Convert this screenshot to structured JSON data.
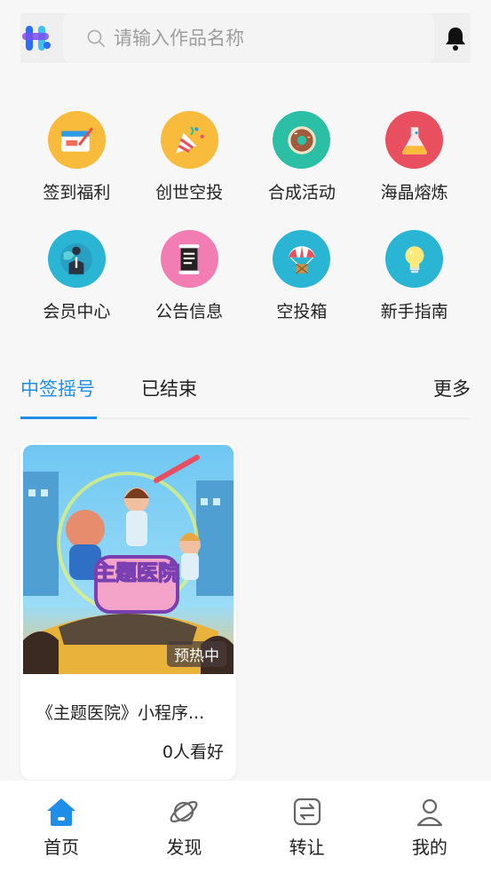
{
  "header": {
    "search_placeholder": "请输入作品名称"
  },
  "grid": [
    {
      "label": "签到福利",
      "color": "#f8bb3c"
    },
    {
      "label": "创世空投",
      "color": "#f8bb3c"
    },
    {
      "label": "合成活动",
      "color": "#2bbfa6"
    },
    {
      "label": "海晶熔炼",
      "color": "#e8505f"
    },
    {
      "label": "会员中心",
      "color": "#2ab5d5"
    },
    {
      "label": "公告信息",
      "color": "#f27db3"
    },
    {
      "label": "空投箱",
      "color": "#2ab5d5"
    },
    {
      "label": "新手指南",
      "color": "#2ab5d5"
    }
  ],
  "tabs": {
    "items": [
      "中签摇号",
      "已结束"
    ],
    "more": "更多",
    "active_color": "#1e8ee8"
  },
  "card": {
    "badge": "预热中",
    "title": "《主题医院》小程序...",
    "views": "0人看好",
    "cover_text": "主题医院"
  },
  "bottom_nav": [
    {
      "label": "首页",
      "icon": "home-icon",
      "active": true
    },
    {
      "label": "发现",
      "icon": "planet-icon"
    },
    {
      "label": "转让",
      "icon": "transfer-icon"
    },
    {
      "label": "我的",
      "icon": "user-icon"
    }
  ]
}
